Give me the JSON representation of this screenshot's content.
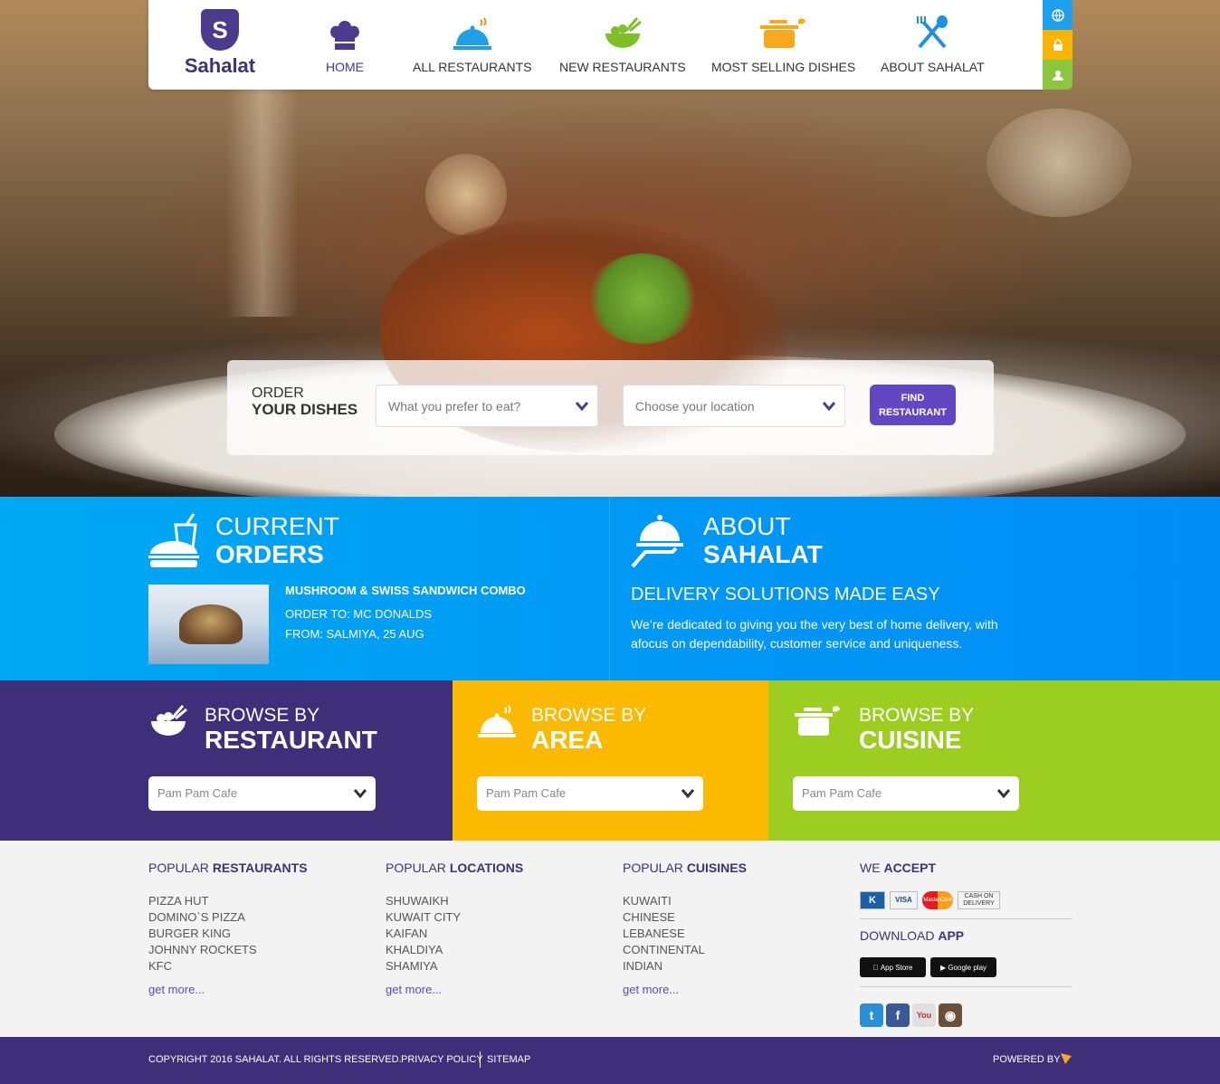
{
  "brand": {
    "name": "Sahalat",
    "tagline": "Sahalat",
    "logo_letter": "S"
  },
  "nav": [
    {
      "label": "HOME",
      "icon": "chef-hat-icon"
    },
    {
      "label": "ALL RESTAURANTS",
      "icon": "cloche-icon"
    },
    {
      "label": "NEW RESTAURANTS",
      "icon": "bowl-icon"
    },
    {
      "label": "MOST SELLING DISHES",
      "icon": "pot-icon"
    },
    {
      "label": "ABOUT SAHALAT",
      "icon": "fork-spoon-icon"
    }
  ],
  "side_buttons": [
    {
      "icon": "globe-icon",
      "color": "#1ea0f0"
    },
    {
      "icon": "lock-icon",
      "color": "#f7b400"
    },
    {
      "icon": "user-icon",
      "color": "#8cc63f"
    }
  ],
  "search": {
    "label_line1": "ORDER",
    "label_line2": "YOUR DISHES",
    "dish_placeholder": "What you prefer to eat?",
    "location_placeholder": "Choose your location",
    "find_line1": "FIND",
    "find_line2": "RESTAURANT"
  },
  "current_orders": {
    "title_line1": "CURRENT",
    "title_line2": "ORDERS",
    "dish": "MUSHROOM & SWISS SANDWICH COMBO",
    "order_to": "ORDER TO: MC DONALDS",
    "from": "FROM: SALMIYA, 25 AUG"
  },
  "about": {
    "title_line1": "ABOUT",
    "title_line2": "SAHALAT",
    "subtitle": "DELIVERY SOLUTIONS MADE EASY",
    "desc": "We’re dedicated to giving you the very best of home delivery, with afocus on dependability, customer service and uniqueness."
  },
  "browse": [
    {
      "line1": "BROWSE BY",
      "line2": "RESTAURANT",
      "value": "Pam Pam Cafe",
      "color": "#3e2f7a"
    },
    {
      "line1": "BROWSE BY",
      "line2": "AREA",
      "value": "Pam Pam Cafe",
      "color": "#fbb900"
    },
    {
      "line1": "BROWSE BY",
      "line2": "CUISINE",
      "value": "Pam Pam Cafe",
      "color": "#9ccd21"
    }
  ],
  "popular": [
    {
      "prefix": "POPULAR ",
      "bold": "RESTAURANTS",
      "items": [
        "PIZZA HUT",
        "DOMINO`S PIZZA",
        "BURGER KING",
        "JOHNNY ROCKETS",
        "KFC"
      ],
      "more": "get more..."
    },
    {
      "prefix": "POPULAR ",
      "bold": "LOCATIONS",
      "items": [
        "SHUWAIKH",
        "KUWAIT CITY",
        "KAIFAN",
        "KHALDIYA",
        "SHAMIYA"
      ],
      "more": "get more..."
    },
    {
      "prefix": "POPULAR ",
      "bold": "CUISINES",
      "items": [
        "KUWAITI",
        "CHINESE",
        "LEBANESE",
        "CONTINENTAL",
        "INDIAN"
      ],
      "more": "get more..."
    }
  ],
  "accept": {
    "prefix": "WE ",
    "bold": "ACCEPT",
    "cards": [
      "K",
      "VISA",
      "MasterCard",
      "CASH ON DELIVERY"
    ],
    "download_prefix": "DOWNLOAD ",
    "download_bold": "APP",
    "apps": [
      "App Store",
      "Google play"
    ],
    "social": [
      "twitter-icon",
      "facebook-icon",
      "youtube-icon",
      "instagram-icon"
    ]
  },
  "footer": {
    "copyright": "COPYRIGHT 2016 SAHALAT. ALL RIGHTS RESERVED.",
    "privacy": "PRIVACY POLICY",
    "sitemap": "SITEMAP",
    "powered": "POWERED BY"
  }
}
